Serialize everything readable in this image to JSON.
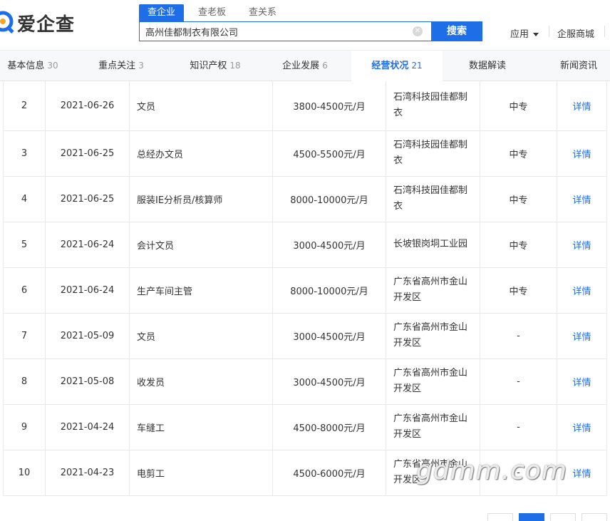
{
  "header": {
    "logo_text": "爱企查",
    "search_tabs": [
      "查企业",
      "查老板",
      "查关系"
    ],
    "search_value": "高州佳都制衣有限公司",
    "search_button": "搜索",
    "apps_menu": "应用",
    "mall_link": "企服商城"
  },
  "nav": {
    "items": [
      {
        "label": "基本信息",
        "count": "30"
      },
      {
        "label": "重点关注",
        "count": "3"
      },
      {
        "label": "知识产权",
        "count": "18"
      },
      {
        "label": "企业发展",
        "count": "6"
      },
      {
        "label": "经营状况",
        "count": "21"
      },
      {
        "label": "数据解读",
        "count": ""
      },
      {
        "label": "新闻资讯",
        "count": ""
      }
    ]
  },
  "table": {
    "action_label": "详情",
    "rows": [
      {
        "idx": "2",
        "date": "2021-06-26",
        "title": "文员",
        "salary": "3800-4500元/月",
        "location": "石湾科技园佳都制衣",
        "education": "中专"
      },
      {
        "idx": "3",
        "date": "2021-06-25",
        "title": "总经办文员",
        "salary": "4500-5500元/月",
        "location": "石湾科技园佳都制衣",
        "education": "中专"
      },
      {
        "idx": "4",
        "date": "2021-06-25",
        "title": "服装IE分析员/核算师",
        "salary": "8000-10000元/月",
        "location": "石湾科技园佳都制衣",
        "education": "中专"
      },
      {
        "idx": "5",
        "date": "2021-06-24",
        "title": "会计文员",
        "salary": "3000-4500元/月",
        "location": "长坡银岗垌工业园",
        "education": "中专"
      },
      {
        "idx": "6",
        "date": "2021-06-24",
        "title": "生产车间主管",
        "salary": "8000-10000元/月",
        "location": "广东省高州市金山开发区",
        "education": "中专"
      },
      {
        "idx": "7",
        "date": "2021-05-09",
        "title": "文员",
        "salary": "3000-4500元/月",
        "location": "广东省高州市金山开发区",
        "education": "-"
      },
      {
        "idx": "8",
        "date": "2021-05-08",
        "title": "收发员",
        "salary": "3000-4500元/月",
        "location": "广东省高州市金山开发区",
        "education": "-"
      },
      {
        "idx": "9",
        "date": "2021-04-24",
        "title": "车缝工",
        "salary": "4500-8000元/月",
        "location": "广东省高州市金山开发区",
        "education": "-"
      },
      {
        "idx": "10",
        "date": "2021-04-23",
        "title": "电剪工",
        "salary": "4500-6000元/月",
        "location": "广东省高州市金山开发区",
        "education": "-"
      }
    ]
  },
  "watermark": "gdmm.com"
}
